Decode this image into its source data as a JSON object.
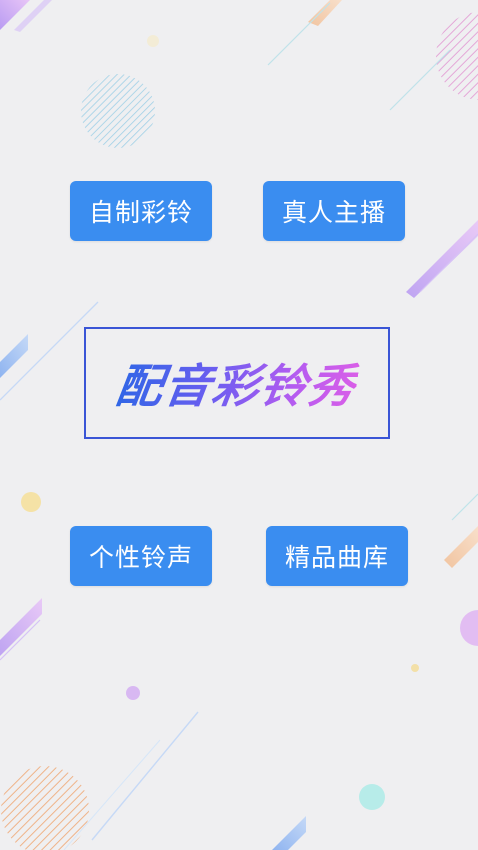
{
  "buttons": {
    "zizhi": "自制彩铃",
    "zhenren": "真人主播",
    "gexing": "个性铃声",
    "jingpin": "精品曲库"
  },
  "title": "配音彩铃秀",
  "colors": {
    "background": "#efeff1",
    "button": "#3a8df0",
    "title_border": "#3a55d6",
    "title_gradient_start": "#2f66e6",
    "title_gradient_end": "#d95ee8"
  }
}
